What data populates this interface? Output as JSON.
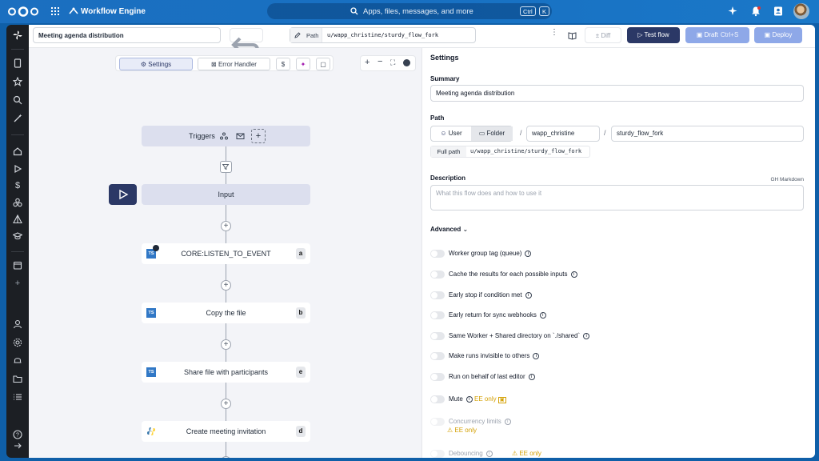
{
  "topbar": {
    "app_title": "Workflow Engine",
    "search_placeholder": "Apps, files, messages, and more",
    "shortcut_ctrl": "Ctrl",
    "shortcut_key": "K"
  },
  "header": {
    "summary_value": "Meeting agenda distribution",
    "path_label": "Path",
    "path_value": "u/wapp_christine/sturdy_flow_fork",
    "diff_label": "Diff",
    "test_flow_label": "Test flow",
    "draft_label": "Draft",
    "draft_shortcut": "Ctrl+S",
    "deploy_label": "Deploy"
  },
  "canvas": {
    "settings_tab": "Settings",
    "error_handler_tab": "Error Handler",
    "dollar_label": "$",
    "triggers_label": "Triggers",
    "input_label": "Input",
    "nodes": [
      {
        "label": "CORE:LISTEN_TO_EVENT",
        "badge": "a",
        "lang": "TS"
      },
      {
        "label": "Copy the file",
        "badge": "b",
        "lang": "TS"
      },
      {
        "label": "Share file with participants",
        "badge": "e",
        "lang": "TS"
      },
      {
        "label": "Create meeting invitation",
        "badge": "d",
        "lang": "python"
      }
    ],
    "plus": "+"
  },
  "panel": {
    "title": "Settings",
    "summary_label": "Summary",
    "summary_value": "Meeting agenda distribution",
    "path_label": "Path",
    "user_option": "User",
    "folder_option": "Folder",
    "owner_value": "wapp_christine",
    "name_value": "sturdy_flow_fork",
    "full_path_label": "Full path",
    "full_path_value": "u/wapp_christine/sturdy_flow_fork",
    "slash": "/",
    "description_label": "Description",
    "markdown_hint": "GH Markdown",
    "description_placeholder": "What this flow does and how to use it",
    "advanced_label": "Advanced",
    "options": [
      "Worker group tag (queue)",
      "Cache the results for each possible inputs",
      "Early stop if condition met",
      "Early return for sync webhooks",
      "Same Worker + Shared directory on `./shared`",
      "Make runs invisible to others",
      "Run on behalf of last editor",
      "Mute",
      "Concurrency limits",
      "Debouncing"
    ],
    "ee_only": "EE only"
  },
  "colors": {
    "primary": "#2b3866",
    "accent": "#8ea8e8",
    "warning": "#d4a106"
  }
}
